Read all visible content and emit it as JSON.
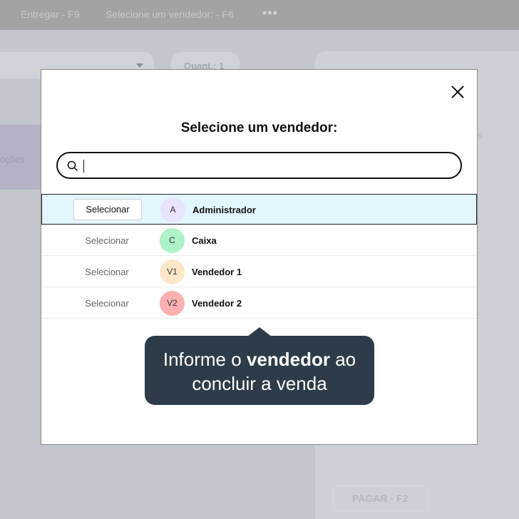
{
  "app": {
    "topbar": {
      "deliver_label": "Entregar - F9",
      "select_seller_label": "Selecione um vendedor: - F6",
      "more_label": "•••"
    },
    "quantity_label": "Quant.: 1",
    "promotions_label": "oções",
    "side_label": "s",
    "pay_button_label": "PAGAR - F2"
  },
  "modal": {
    "title": "Selecione um vendedor:",
    "search": {
      "value": "",
      "placeholder": ""
    },
    "sellers": [
      {
        "select_label": "Selecionar",
        "initials": "A",
        "name": "Administrador",
        "avatar_color": "#e9e3fc",
        "highlighted": true
      },
      {
        "select_label": "Selecionar",
        "initials": "C",
        "name": "Caixa",
        "avatar_color": "#adf2c8"
      },
      {
        "select_label": "Selecionar",
        "initials": "V1",
        "name": "Vendedor 1",
        "avatar_color": "#fde7c9"
      },
      {
        "select_label": "Selecionar",
        "initials": "V2",
        "name": "Vendedor 2",
        "avatar_color": "#fdb0b0"
      }
    ]
  },
  "tooltip": {
    "before": "Informe o ",
    "emphasis": "vendedor",
    "after": " ao concluir a venda"
  }
}
